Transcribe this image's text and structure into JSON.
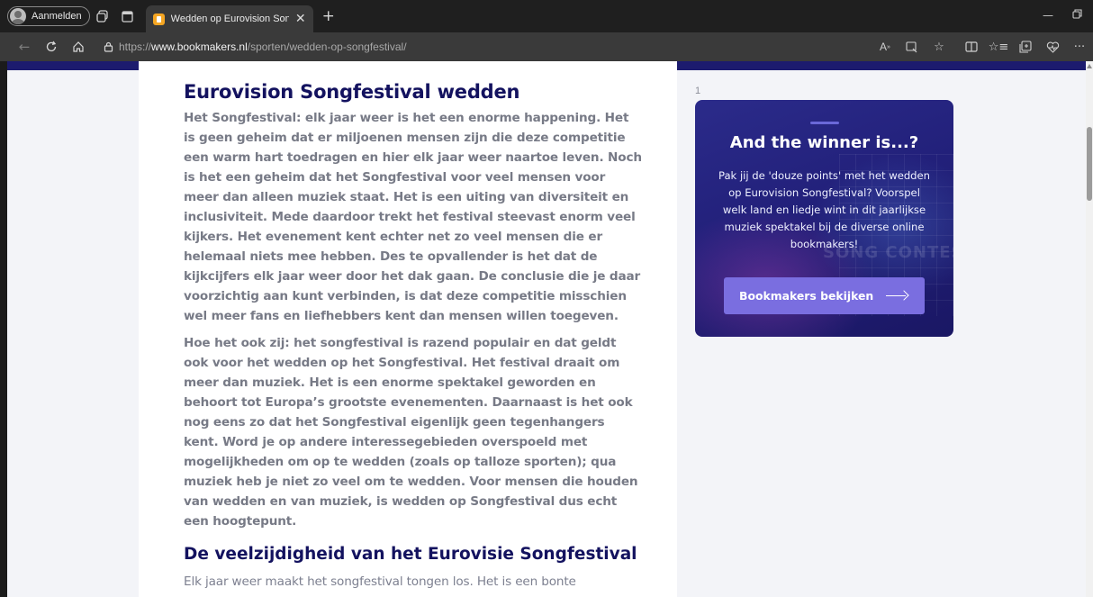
{
  "browser": {
    "profile_label": "Aanmelden",
    "tab_title": "Wedden op Eurovision Songfesti",
    "url_prefix": "https://",
    "url_host": "www.bookmakers.nl",
    "url_path": "/sporten/wedden-op-songfestival/",
    "icons": {
      "workspaces": "workspaces-icon",
      "tab_actions": "tab-actions-icon",
      "back": "back-arrow-icon",
      "refresh": "refresh-icon",
      "home": "home-icon",
      "lock": "lock-icon",
      "read_aloud": "read-aloud-icon",
      "immersive": "immersive-reader-icon",
      "favorite": "star-icon",
      "split": "split-screen-icon",
      "favorites": "favorites-icon",
      "collections": "collections-icon",
      "health": "browser-essentials-icon",
      "more": "more-icon"
    }
  },
  "article": {
    "title": "Eurovision Songfestival wedden",
    "paragraph1": "Het Songfestival: elk jaar weer is het een enorme happening. Het is geen geheim dat er miljoenen mensen zijn die deze competitie een warm hart toedragen en hier elk jaar weer naartoe leven. Noch is het een geheim dat het Songfestival voor veel mensen voor meer dan alleen muziek staat. Het is een uiting van diversiteit en inclusiviteit. Mede daardoor trekt het festival steevast enorm veel kijkers. Het evenement kent echter net zo veel mensen die er helemaal niets mee hebben. Des te opvallender is het dat de kijkcijfers elk jaar weer door het dak gaan. De conclusie die je daar voorzichtig aan kunt verbinden, is dat deze competitie misschien wel meer fans en liefhebbers kent dan mensen willen toegeven.",
    "paragraph2": "Hoe het ook zij: het songfestival is razend populair en dat geldt ook voor het wedden op het Songfestival. Het festival draait om meer dan muziek. Het is een enorme spektakel geworden en behoort tot Europa’s grootste evenementen. Daarnaast is het ook nog eens zo dat het Songfestival eigenlijk geen tegenhangers kent. Word je op andere interessegebieden overspoeld met mogelijkheden om op te wedden (zoals op talloze sporten); qua muziek heb je niet zo veel om te wedden. Voor mensen die houden van wedden en van muziek, is wedden op Songfestival dus echt een hoogtepunt.",
    "subtitle": "De veelzijdigheid van het Eurovisie Songfestival",
    "paragraph3": "Elk jaar weer maakt het songfestival tongen los. Het is een bonte"
  },
  "sidebar": {
    "footnote": "1",
    "promo_title": "And the winner is...?",
    "promo_text": "Pak jij de 'douze points' met het wedden op Eurovision Songfestival? Voorspel welk land en liedje wint in dit jaarlijkse muziek spektakel bij de diverse online bookmakers!",
    "watermark": "SONG CONTEST",
    "button_label": "Bookmakers bekijken"
  }
}
